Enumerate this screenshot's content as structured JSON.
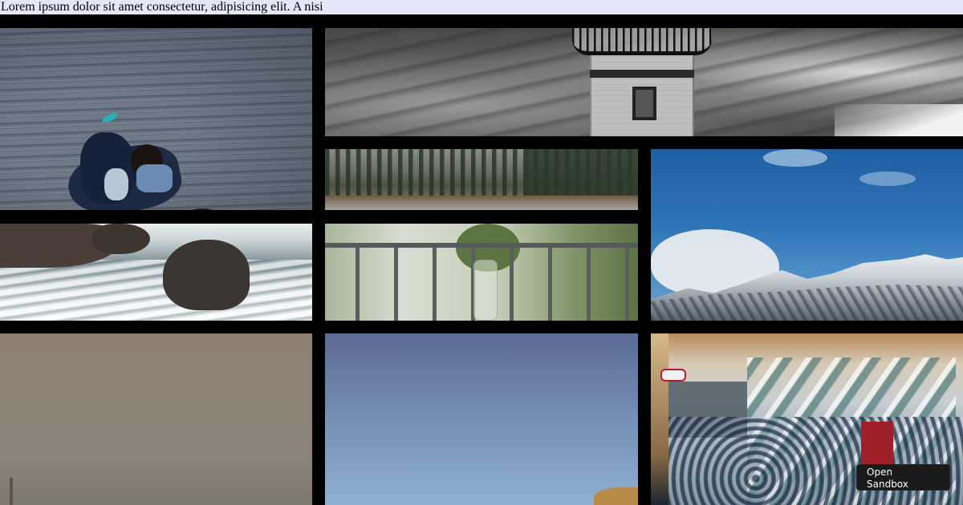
{
  "header": {
    "text": "Lorem ipsum dolor sit amet consectetur, adipisicing elit. A nisi"
  },
  "gallery": {
    "tiles": [
      {
        "name": "photo-couple-on-deck"
      },
      {
        "name": "photo-lighthouse"
      },
      {
        "name": "photo-forest-river"
      },
      {
        "name": "photo-snowy-mountains"
      },
      {
        "name": "photo-rocks-and-waves"
      },
      {
        "name": "photo-balcony-plant"
      },
      {
        "name": "photo-foggy-landscape"
      },
      {
        "name": "photo-blue-sky"
      },
      {
        "name": "photo-mall-escalators"
      }
    ]
  },
  "sandbox_button": {
    "label": "Open\nSandbox"
  }
}
